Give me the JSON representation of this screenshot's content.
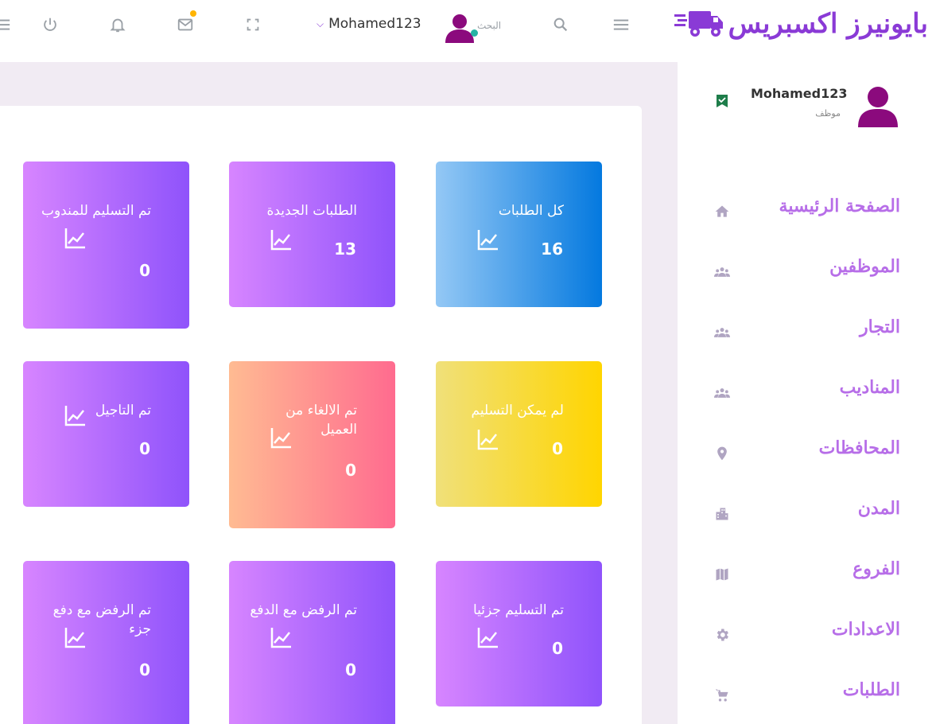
{
  "header": {
    "logo_text": "بايونيرز اكسبريس",
    "search_placeholder": "البحث",
    "username": "Mohamed123",
    "icons": [
      "menu-icon",
      "search-icon",
      "fullscreen-icon",
      "mail-icon",
      "bell-icon",
      "power-icon"
    ],
    "colors": {
      "brand": "#8a3ad6",
      "online": "#26b4a4",
      "notification": "#ffb400"
    }
  },
  "sidebar": {
    "profile": {
      "name": "Mohamed123",
      "role": "موظف"
    },
    "items": [
      {
        "label": "الصفحة الرئيسية",
        "icon": "home-icon"
      },
      {
        "label": "الموظفين",
        "icon": "people-icon"
      },
      {
        "label": "التجار",
        "icon": "people-icon"
      },
      {
        "label": "المناديب",
        "icon": "people-icon"
      },
      {
        "label": "المحافظات",
        "icon": "location-icon"
      },
      {
        "label": "المدن",
        "icon": "city-icon"
      },
      {
        "label": "الفروع",
        "icon": "map-icon"
      },
      {
        "label": "الاعدادات",
        "icon": "gear-icon"
      },
      {
        "label": "الطلبات",
        "icon": "cart-icon"
      }
    ]
  },
  "cards": [
    {
      "title": "كل الطلبات",
      "value": "16",
      "color": "blue"
    },
    {
      "title": "الطلبات الجديدة",
      "value": "13",
      "color": "purple"
    },
    {
      "title": "تم التسليم للمندوب",
      "value": "0",
      "color": "purple"
    },
    {
      "title": "لم يمكن التسليم",
      "value": "0",
      "color": "yellow"
    },
    {
      "title": "تم الالغاء من العميل",
      "value": "0",
      "color": "pink"
    },
    {
      "title": "تم التاجيل",
      "value": "0",
      "color": "purple"
    },
    {
      "title": "تم التسليم جزئيا",
      "value": "0",
      "color": "purple"
    },
    {
      "title": "تم الرفض مع الدفع",
      "value": "0",
      "color": "purple"
    },
    {
      "title": "تم الرفض مع دفع جزء",
      "value": "0",
      "color": "purple"
    }
  ]
}
